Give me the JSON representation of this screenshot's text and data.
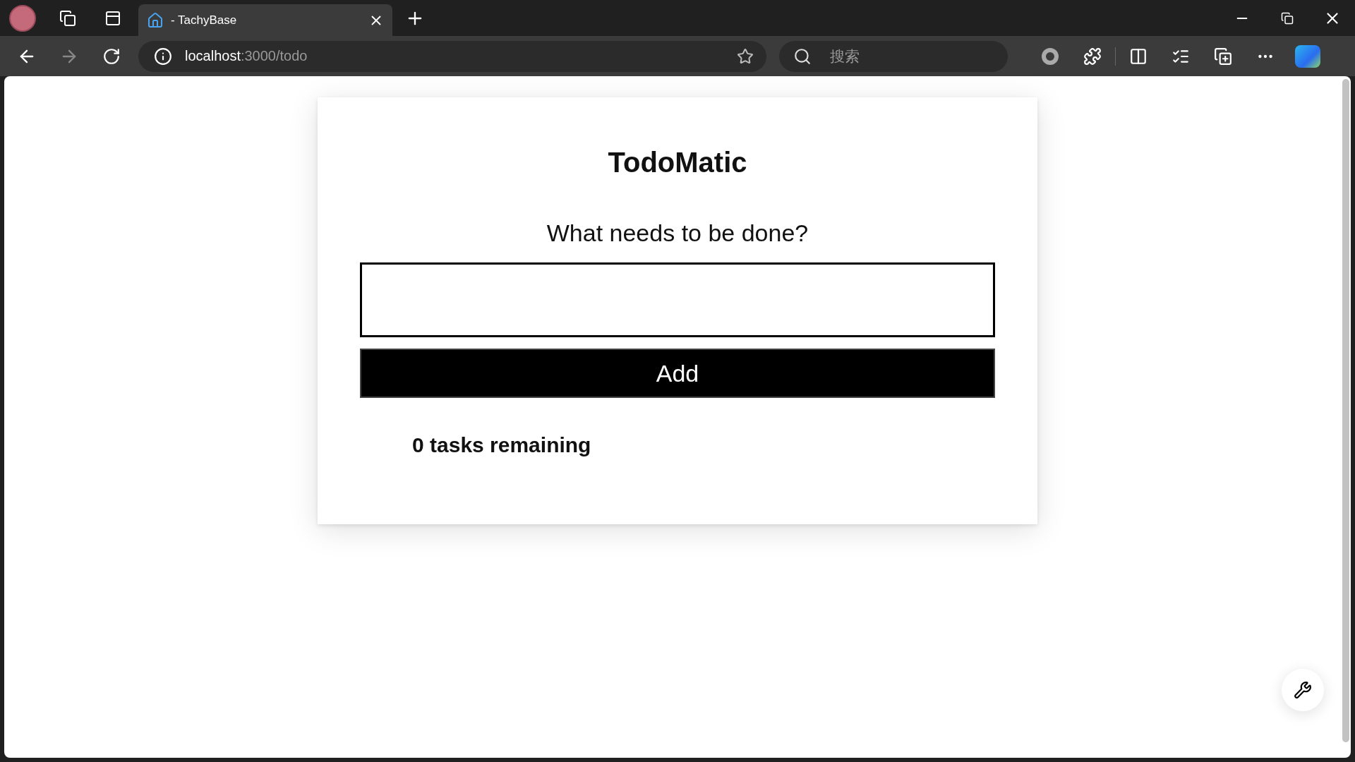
{
  "browser": {
    "tab": {
      "title": "- TachyBase",
      "selected": true
    },
    "url": {
      "host": "localhost",
      "path": ":3000/todo"
    },
    "search": {
      "placeholder": "搜索"
    }
  },
  "app": {
    "title": "TodoMatic",
    "prompt": "What needs to be done?",
    "add_button": "Add",
    "remaining": "0 tasks remaining"
  }
}
